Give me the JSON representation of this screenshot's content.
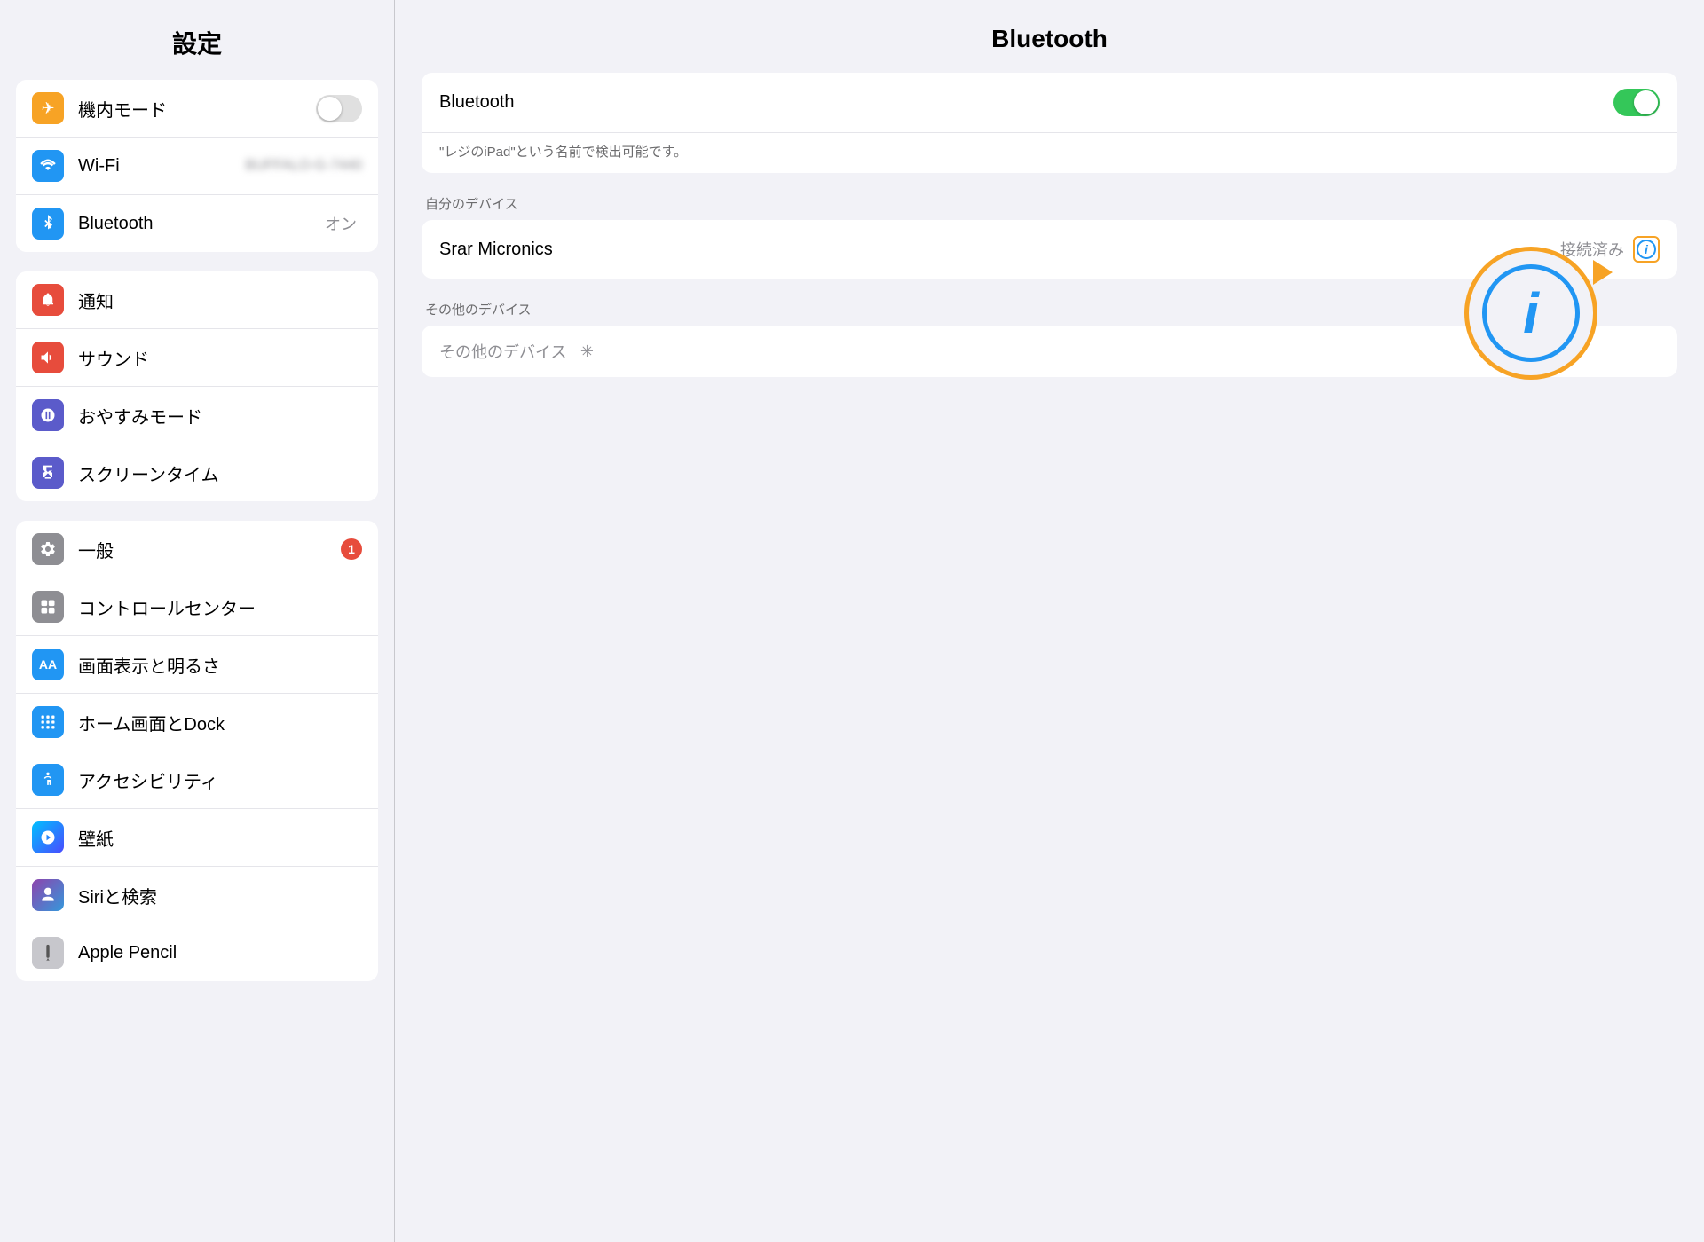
{
  "sidebar": {
    "title": "設定",
    "groups": [
      {
        "id": "group1",
        "items": [
          {
            "id": "airplane",
            "label": "機内モード",
            "icon": "airplane",
            "iconClass": "icon-airplane",
            "iconSymbol": "✈",
            "value": "",
            "hasToggle": true,
            "toggleOn": false,
            "badge": null
          },
          {
            "id": "wifi",
            "label": "Wi-Fi",
            "icon": "wifi",
            "iconClass": "icon-wifi",
            "iconSymbol": "wifi",
            "value": "BUFFALO-G-7440",
            "hasToggle": false,
            "toggleOn": false,
            "badge": null
          },
          {
            "id": "bluetooth",
            "label": "Bluetooth",
            "icon": "bluetooth",
            "iconClass": "icon-bluetooth",
            "iconSymbol": "bluetooth",
            "value": "オン",
            "hasToggle": false,
            "toggleOn": false,
            "badge": null
          }
        ]
      },
      {
        "id": "group2",
        "items": [
          {
            "id": "notification",
            "label": "通知",
            "icon": "notification",
            "iconClass": "icon-notification",
            "iconSymbol": "🔔",
            "value": "",
            "hasToggle": false,
            "badge": null
          },
          {
            "id": "sound",
            "label": "サウンド",
            "icon": "sound",
            "iconClass": "icon-sound",
            "iconSymbol": "🔊",
            "value": "",
            "hasToggle": false,
            "badge": null
          },
          {
            "id": "donotdisturb",
            "label": "おやすみモード",
            "icon": "donotdisturb",
            "iconClass": "icon-donotdisturb",
            "iconSymbol": "🌙",
            "value": "",
            "hasToggle": false,
            "badge": null
          },
          {
            "id": "screentime",
            "label": "スクリーンタイム",
            "icon": "screentime",
            "iconClass": "icon-screentime",
            "iconSymbol": "⏳",
            "value": "",
            "hasToggle": false,
            "badge": null
          }
        ]
      },
      {
        "id": "group3",
        "items": [
          {
            "id": "general",
            "label": "一般",
            "icon": "general",
            "iconClass": "icon-general",
            "iconSymbol": "⚙",
            "value": "",
            "hasToggle": false,
            "badge": "1"
          },
          {
            "id": "controlcenter",
            "label": "コントロールセンター",
            "icon": "controlcenter",
            "iconClass": "icon-controlcenter",
            "iconSymbol": "⊞",
            "value": "",
            "hasToggle": false,
            "badge": null
          },
          {
            "id": "display",
            "label": "画面表示と明るさ",
            "icon": "display",
            "iconClass": "icon-display",
            "iconSymbol": "AA",
            "value": "",
            "hasToggle": false,
            "badge": null
          },
          {
            "id": "homescreen",
            "label": "ホーム画面とDock",
            "icon": "homescreen",
            "iconClass": "icon-homescreen",
            "iconSymbol": "⊞",
            "value": "",
            "hasToggle": false,
            "badge": null
          },
          {
            "id": "accessibility",
            "label": "アクセシビリティ",
            "icon": "accessibility",
            "iconClass": "icon-accessibility",
            "iconSymbol": "♿",
            "value": "",
            "hasToggle": false,
            "badge": null
          },
          {
            "id": "wallpaper",
            "label": "壁紙",
            "icon": "wallpaper",
            "iconClass": "icon-wallpaper",
            "iconSymbol": "✿",
            "value": "",
            "hasToggle": false,
            "badge": null
          },
          {
            "id": "siri",
            "label": "Siriと検索",
            "icon": "siri",
            "iconClass": "icon-siri-grad",
            "iconSymbol": "",
            "value": "",
            "hasToggle": false,
            "badge": null
          },
          {
            "id": "applepencil",
            "label": "Apple Pencil",
            "icon": "applepencil",
            "iconClass": "icon-applepencil-light",
            "iconSymbol": "",
            "value": "",
            "hasToggle": false,
            "badge": null
          }
        ]
      }
    ]
  },
  "main": {
    "title": "Bluetooth",
    "bluetooth_label": "Bluetooth",
    "bluetooth_toggle_on": true,
    "description": "\"レジのiPad\"という名前で検出可能です。",
    "my_devices_label": "自分のデバイス",
    "device_name": "Srar Micronics",
    "device_status": "接続済み",
    "other_devices_label": "その他のデバイス",
    "info_button_label": "i"
  }
}
